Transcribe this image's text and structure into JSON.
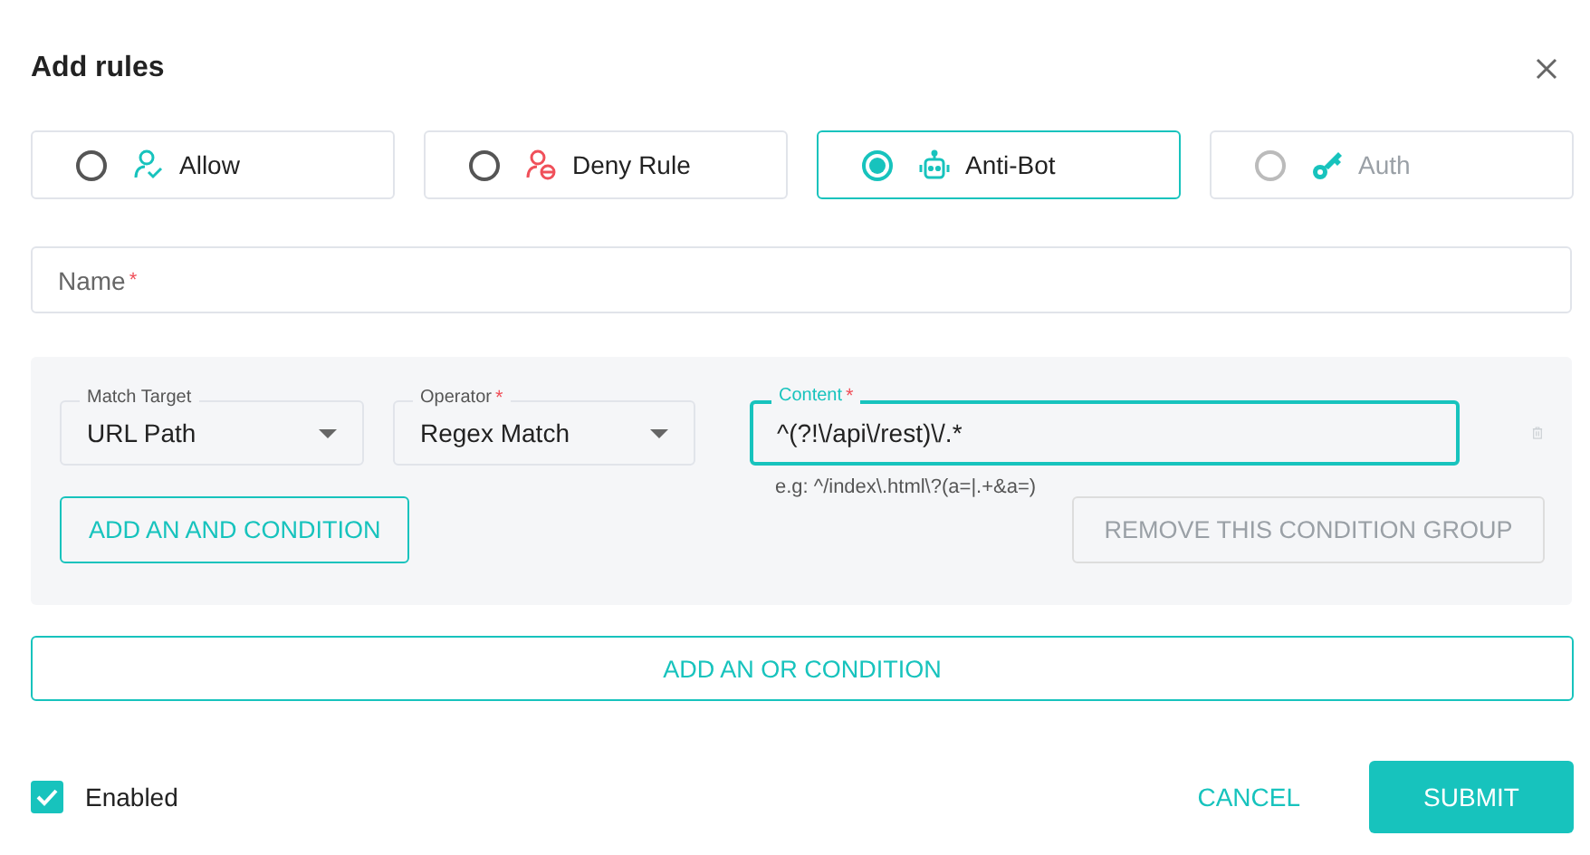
{
  "dialog": {
    "title": "Add rules"
  },
  "rule_types": [
    {
      "label": "Allow",
      "kind": "allow",
      "selected": false,
      "disabled": false
    },
    {
      "label": "Deny Rule",
      "kind": "deny",
      "selected": false,
      "disabled": false
    },
    {
      "label": "Anti-Bot",
      "kind": "bot",
      "selected": true,
      "disabled": false
    },
    {
      "label": "Auth",
      "kind": "auth",
      "selected": false,
      "disabled": true
    }
  ],
  "name_field": {
    "label": "Name",
    "mark": "*"
  },
  "condition_group": {
    "fields": [
      {
        "kind": "select",
        "label": "Match Target",
        "value": "URL Path"
      },
      {
        "kind": "select",
        "label": "Operator",
        "mark": "*",
        "value": "Regex Match"
      },
      {
        "kind": "text",
        "label": "Content",
        "mark": "*",
        "value": "^(?!\\/api\\/rest)\\/.*",
        "focused": true,
        "hint": "e.g: ^/index\\.html\\?(a=|.+&a=)"
      }
    ],
    "add_and": {
      "label": "ADD AN AND CONDITION"
    },
    "remove_group": {
      "label": "REMOVE THIS CONDITION GROUP",
      "disabled": true
    }
  },
  "add_or": {
    "label": "ADD AN OR CONDITION"
  },
  "enabled": {
    "label": "Enabled",
    "checked": true
  },
  "cancel": {
    "label": "CANCEL"
  },
  "submit": {
    "label": "SUBMIT"
  }
}
